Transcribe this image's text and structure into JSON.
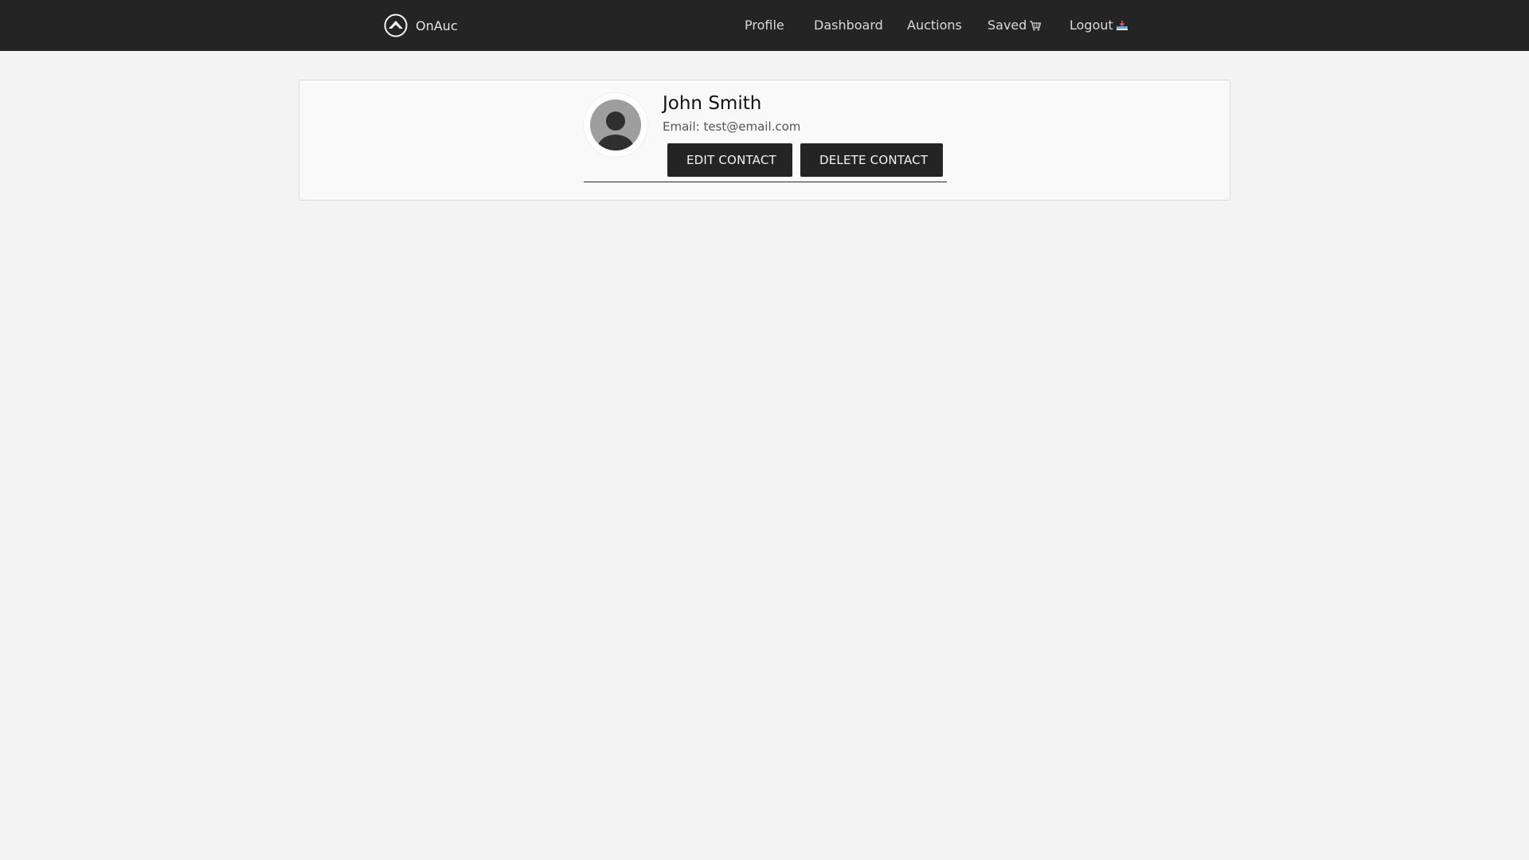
{
  "navbar": {
    "brand": "OnAuc",
    "links": [
      {
        "label": "Profile"
      },
      {
        "label": "Dashboard"
      },
      {
        "label": "Auctions"
      },
      {
        "label": "Saved",
        "icon": "cart-icon"
      },
      {
        "label": "Logout",
        "icon": "logout-icon"
      }
    ]
  },
  "contact": {
    "name": "John Smith",
    "email": "Email: test@email.com",
    "edit_label": "EDIT CONTACT",
    "delete_label": "DELETE CONTACT"
  },
  "colors": {
    "navbar_bg": "#242424",
    "page_bg": "#f3f3f3",
    "button_bg": "#242424",
    "button_text": "#f4f4f4"
  }
}
